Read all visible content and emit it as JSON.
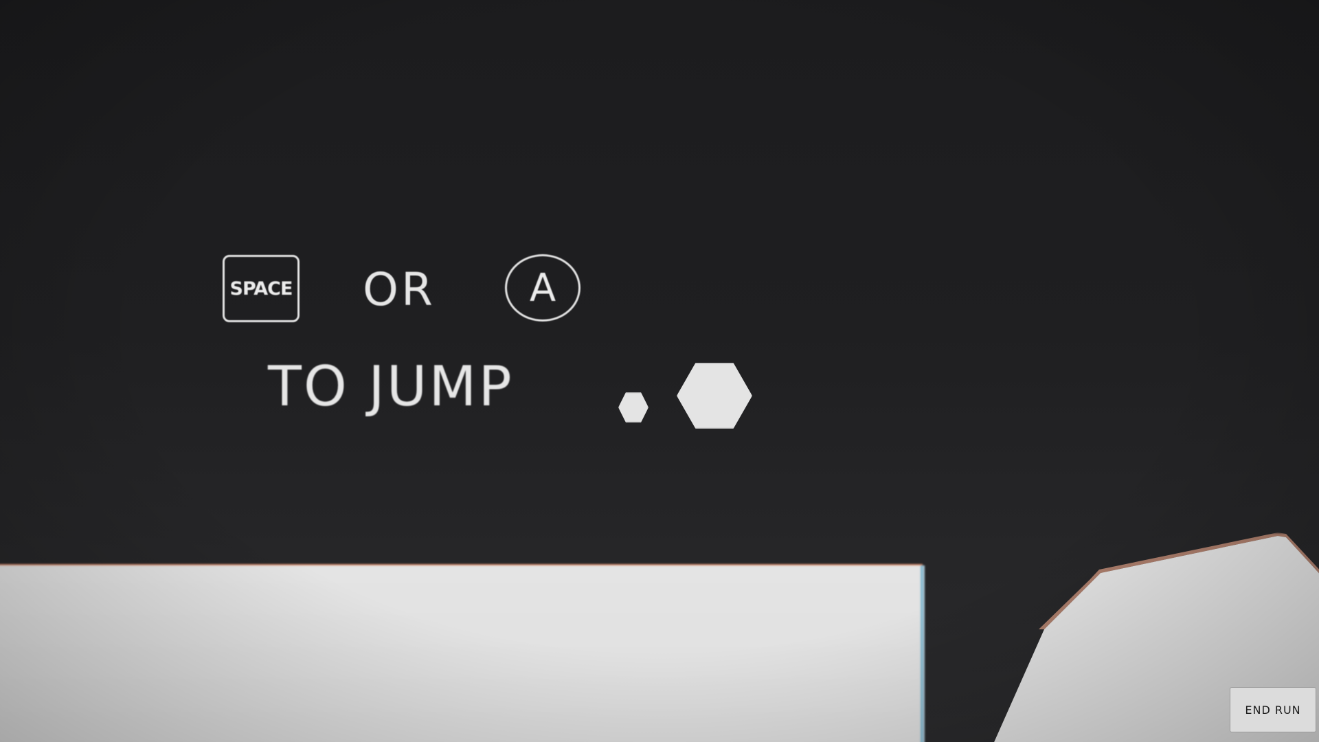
{
  "prompt": {
    "key_label": "SPACE",
    "or_text": "OR",
    "button_label": "A",
    "action_text": "TO JUMP"
  },
  "hud": {
    "end_run_label": "END RUN"
  },
  "colors": {
    "background": "#1f1f21",
    "foreground": "#e4e4e4",
    "edge_warm": "#d98a6a",
    "edge_cool": "#7fb7cf"
  }
}
